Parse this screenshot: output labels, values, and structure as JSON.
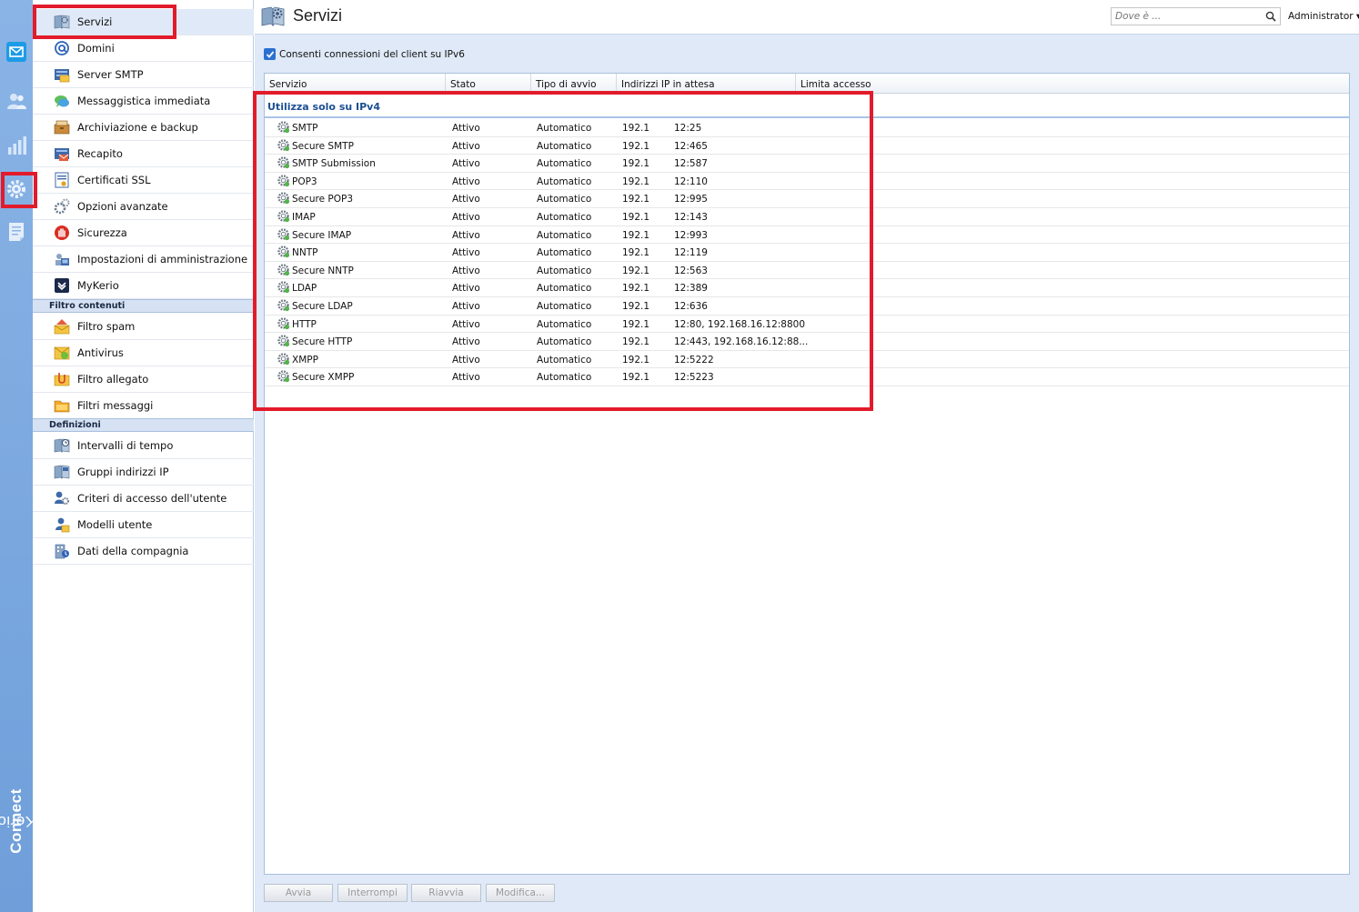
{
  "brand": {
    "name_light": "Kerio",
    "name_bold": "Connect"
  },
  "nav": {
    "items_main": [
      {
        "label": "Servizi",
        "icon": "services-icon"
      },
      {
        "label": "Domini",
        "icon": "at-icon"
      },
      {
        "label": "Server SMTP",
        "icon": "smtp-server-icon"
      },
      {
        "label": "Messaggistica immediata",
        "icon": "chat-icon"
      },
      {
        "label": "Archiviazione e backup",
        "icon": "archive-icon"
      },
      {
        "label": "Recapito",
        "icon": "delivery-icon"
      },
      {
        "label": "Certificati SSL",
        "icon": "certificate-icon"
      },
      {
        "label": "Opzioni avanzate",
        "icon": "gears-icon"
      },
      {
        "label": "Sicurezza",
        "icon": "stop-hand-icon"
      },
      {
        "label": "Impostazioni di amministrazione",
        "icon": "admin-settings-icon"
      },
      {
        "label": "MyKerio",
        "icon": "mykerio-icon"
      }
    ],
    "section_filters": "Filtro contenuti",
    "items_filters": [
      {
        "label": "Filtro spam",
        "icon": "spam-filter-icon"
      },
      {
        "label": "Antivirus",
        "icon": "antivirus-icon"
      },
      {
        "label": "Filtro allegato",
        "icon": "attachment-filter-icon"
      },
      {
        "label": "Filtri messaggi",
        "icon": "message-filter-icon"
      }
    ],
    "section_definitions": "Definizioni",
    "items_definitions": [
      {
        "label": "Intervalli di tempo",
        "icon": "time-ranges-icon"
      },
      {
        "label": "Gruppi indirizzi IP",
        "icon": "ip-groups-icon"
      },
      {
        "label": "Criteri di accesso dell'utente",
        "icon": "access-policy-icon"
      },
      {
        "label": "Modelli utente",
        "icon": "user-templates-icon"
      },
      {
        "label": "Dati della compagnia",
        "icon": "company-data-icon"
      }
    ]
  },
  "header": {
    "title": "Servizi",
    "search_placeholder": "Dove è ...",
    "user": "Administrator ▾"
  },
  "ipv6": {
    "label": "Consenti connessioni del client su IPv6",
    "checked": true
  },
  "grid": {
    "columns": [
      "Servizio",
      "Stato",
      "Tipo di avvio",
      "Indirizzi IP in attesa",
      "Limita accesso"
    ],
    "group_label": "Utilizza solo su IPv4",
    "rows": [
      {
        "name": "SMTP",
        "status": "Attivo",
        "startup": "Automatico",
        "ip_a": "192.1",
        "ip_b": "12:25"
      },
      {
        "name": "Secure SMTP",
        "status": "Attivo",
        "startup": "Automatico",
        "ip_a": "192.1",
        "ip_b": "12:465"
      },
      {
        "name": "SMTP Submission",
        "status": "Attivo",
        "startup": "Automatico",
        "ip_a": "192.1",
        "ip_b": "12:587"
      },
      {
        "name": "POP3",
        "status": "Attivo",
        "startup": "Automatico",
        "ip_a": "192.1",
        "ip_b": "12:110"
      },
      {
        "name": "Secure POP3",
        "status": "Attivo",
        "startup": "Automatico",
        "ip_a": "192.1",
        "ip_b": "12:995"
      },
      {
        "name": "IMAP",
        "status": "Attivo",
        "startup": "Automatico",
        "ip_a": "192.1",
        "ip_b": "12:143"
      },
      {
        "name": "Secure IMAP",
        "status": "Attivo",
        "startup": "Automatico",
        "ip_a": "192.1",
        "ip_b": "12:993"
      },
      {
        "name": "NNTP",
        "status": "Attivo",
        "startup": "Automatico",
        "ip_a": "192.1",
        "ip_b": "12:119"
      },
      {
        "name": "Secure NNTP",
        "status": "Attivo",
        "startup": "Automatico",
        "ip_a": "192.1",
        "ip_b": "12:563"
      },
      {
        "name": "LDAP",
        "status": "Attivo",
        "startup": "Automatico",
        "ip_a": "192.1",
        "ip_b": "12:389"
      },
      {
        "name": "Secure LDAP",
        "status": "Attivo",
        "startup": "Automatico",
        "ip_a": "192.1",
        "ip_b": "12:636"
      },
      {
        "name": "HTTP",
        "status": "Attivo",
        "startup": "Automatico",
        "ip_a": "192.1",
        "ip_b": "12:80, 192.168.16.12:8800"
      },
      {
        "name": "Secure HTTP",
        "status": "Attivo",
        "startup": "Automatico",
        "ip_a": "192.1",
        "ip_b": "12:443, 192.168.16.12:88..."
      },
      {
        "name": "XMPP",
        "status": "Attivo",
        "startup": "Automatico",
        "ip_a": "192.1",
        "ip_b": "12:5222"
      },
      {
        "name": "Secure XMPP",
        "status": "Attivo",
        "startup": "Automatico",
        "ip_a": "192.1",
        "ip_b": "12:5223"
      }
    ]
  },
  "footer": {
    "start": "Avvia",
    "stop": "Interrompi",
    "restart": "Riavvia",
    "edit": "Modifica..."
  },
  "colors": {
    "accent": "#2b70d1",
    "group_text": "#1c4f93",
    "highlight": "#e21b2b",
    "strip": "#7aa6de"
  }
}
